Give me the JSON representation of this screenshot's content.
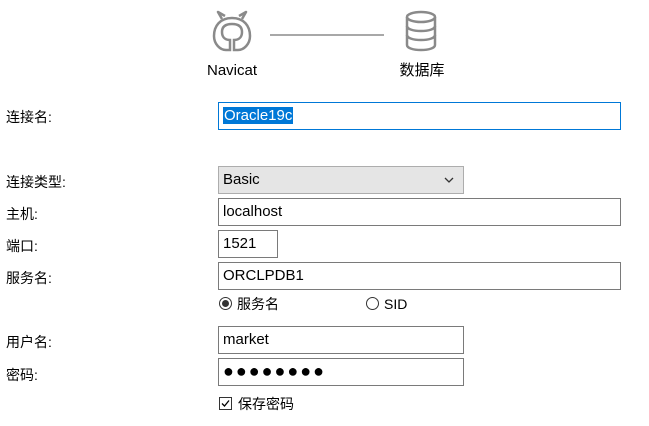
{
  "header": {
    "client_label": "Navicat",
    "database_label": "数据库",
    "client_icon": "navicat-logo-icon",
    "database_icon": "database-icon"
  },
  "form": {
    "connection_name_label": "连接名:",
    "connection_name_value": "Oracle19c",
    "connection_type_label": "连接类型:",
    "connection_type_value": "Basic",
    "host_label": "主机:",
    "host_value": "localhost",
    "port_label": "端口:",
    "port_value": "1521",
    "service_name_label": "服务名:",
    "service_name_value": "ORCLPDB1",
    "radio_service_name": "服务名",
    "radio_sid": "SID",
    "radio_selected": "服务名",
    "username_label": "用户名:",
    "username_value": "market",
    "password_label": "密码:",
    "password_value": "●●●●●●●●",
    "save_password_label": "保存密码",
    "save_password_checked": true
  },
  "colors": {
    "accent": "#0078d7",
    "icon_gray": "#8a8a8a"
  }
}
